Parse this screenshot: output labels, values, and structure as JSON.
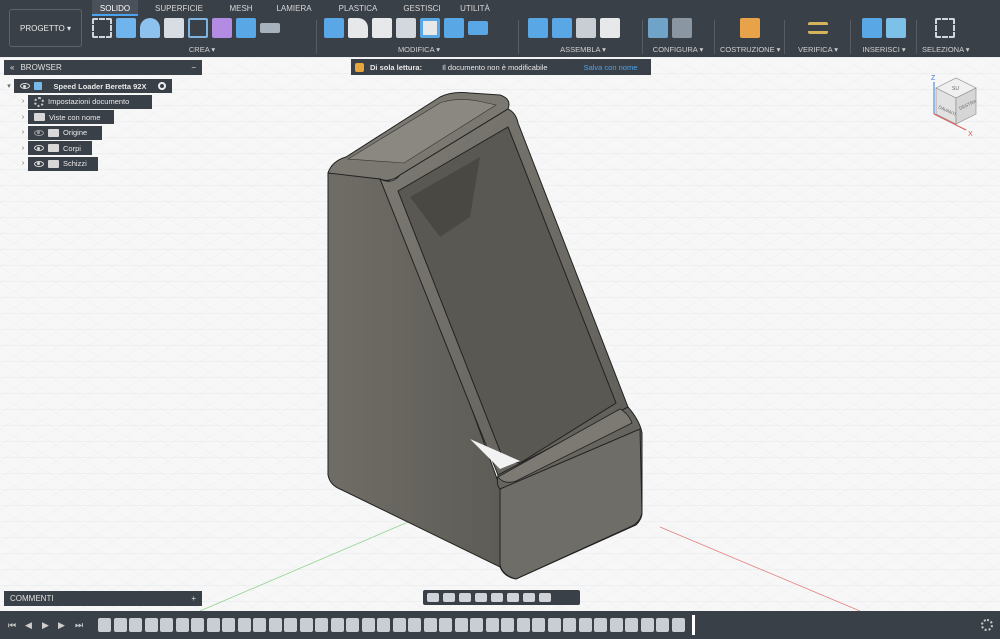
{
  "project_label": "PROGETTO ▾",
  "tabs": [
    "SOLIDO",
    "SUPERFICIE",
    "MESH",
    "LAMIERA",
    "PLASTICA",
    "GESTISCI",
    "UTILITÀ"
  ],
  "groups": {
    "crea": "CREA ▾",
    "modifica": "MODIFICA ▾",
    "assembla": "ASSEMBLA ▾",
    "configura": "CONFIGURA ▾",
    "costruzione": "COSTRUZIONE ▾",
    "verifica": "VERIFICA ▾",
    "inserisci": "INSERISCI ▾",
    "seleziona": "SELEZIONA ▾"
  },
  "browser": {
    "title": "BROWSER",
    "collapse": "«",
    "minus": "−",
    "root": "Speed Loader Beretta 92X",
    "items": [
      "Impostazioni documento",
      "Viste con nome",
      "Origine",
      "Corpi",
      "Schizzi"
    ]
  },
  "banner": {
    "title": "Di sola lettura:",
    "message": "Il documento non è modificabile",
    "link": "Salva con nome"
  },
  "viewcube": {
    "top": "SU",
    "front": "DAVANTI",
    "right": "DESTRA",
    "axis_z": "Z",
    "axis_x": "X"
  },
  "comments": {
    "title": "COMMENTI",
    "plus": "+"
  },
  "colors": {
    "toolbar": "#3a4048",
    "accent": "#4aa3f0",
    "model": "#6b6a64",
    "grid": "#d9dde2"
  }
}
